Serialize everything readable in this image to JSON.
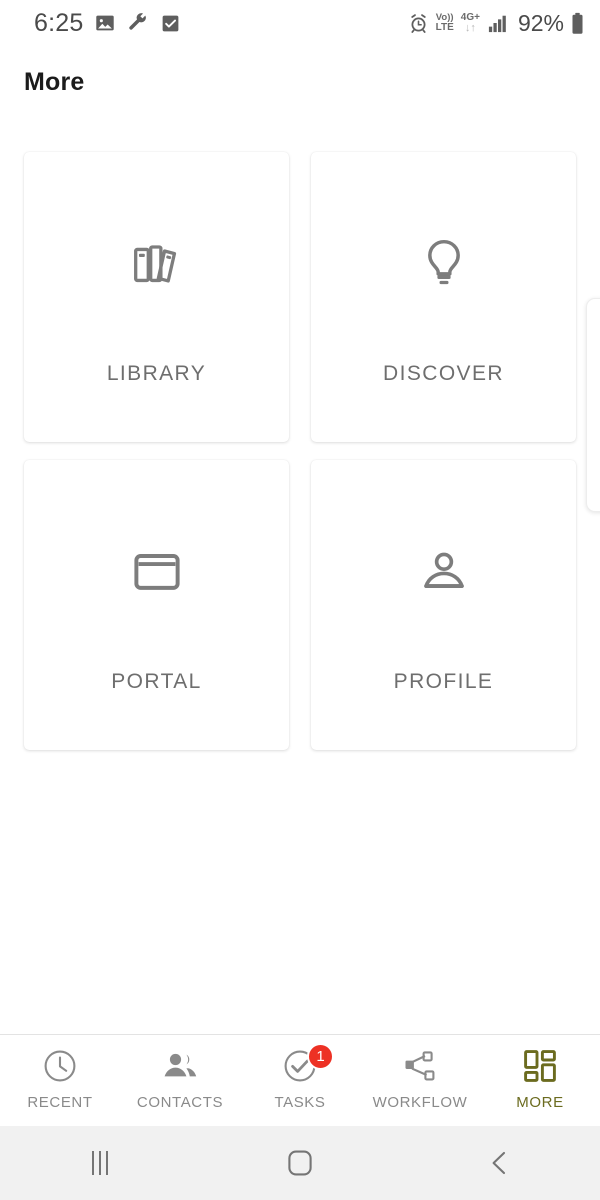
{
  "status_bar": {
    "time": "6:25",
    "left_icons": [
      "image-icon",
      "wrench-icon",
      "checkbox-icon"
    ],
    "alarm_icon": "alarm-clock-icon",
    "volte_top": "Vo))",
    "volte_bottom": "LTE",
    "network_top": "4G+",
    "network_bottom": "↓↑",
    "signal_icon": "signal-bars-icon",
    "battery_percent": "92%",
    "battery_icon": "battery-icon"
  },
  "header": {
    "title": "More"
  },
  "grid": {
    "items": [
      {
        "label": "LIBRARY",
        "icon": "books-icon"
      },
      {
        "label": "DISCOVER",
        "icon": "lightbulb-icon"
      },
      {
        "label": "PORTAL",
        "icon": "window-icon"
      },
      {
        "label": "PROFILE",
        "icon": "person-icon"
      }
    ]
  },
  "tab_bar": {
    "tabs": [
      {
        "label": "RECENT",
        "icon": "clock-icon",
        "active": false,
        "badge": ""
      },
      {
        "label": "CONTACTS",
        "icon": "people-icon",
        "active": false,
        "badge": ""
      },
      {
        "label": "TASKS",
        "icon": "check-circle-icon",
        "active": false,
        "badge": "1"
      },
      {
        "label": "WORKFLOW",
        "icon": "share-nodes-icon",
        "active": false,
        "badge": ""
      },
      {
        "label": "MORE",
        "icon": "grid-icon",
        "active": true,
        "badge": ""
      }
    ],
    "active_color": "#6b6b1f",
    "inactive_color": "#8a8a8a",
    "badge_color": "#ed3124"
  },
  "nav_bar": {
    "recents_label": "recents-button",
    "home_label": "home-button",
    "back_label": "back-button"
  },
  "colors": {
    "page_background": "#ffffff",
    "card_background": "#ffffff",
    "icon_gray": "#7d7d7d",
    "label_gray": "#6e6e6e",
    "nav_background": "#f1f1f1"
  }
}
